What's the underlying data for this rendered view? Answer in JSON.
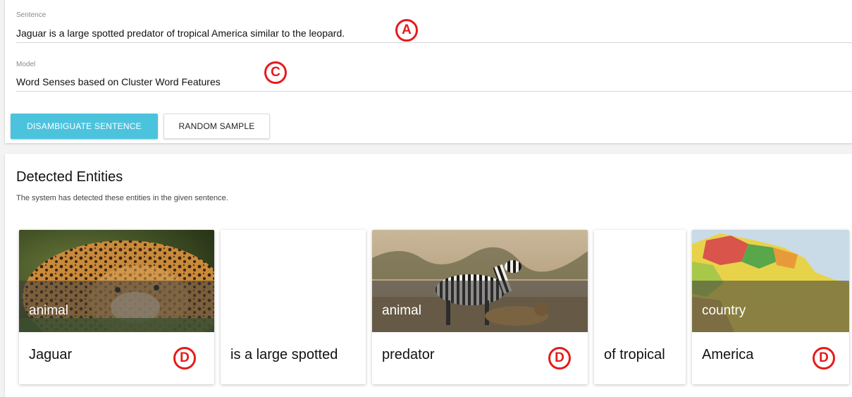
{
  "form": {
    "sentence_label": "Sentence",
    "sentence_value": "Jaguar is a large spotted predator of tropical America similar to the leopard.",
    "model_label": "Model",
    "model_value": "Word Senses based on Cluster Word Features",
    "disambiguate_label": "DISAMBIGUATE SENTENCE",
    "random_label": "RANDOM SAMPLE"
  },
  "markers": {
    "a": "A",
    "c": "C",
    "d": "D"
  },
  "entities": {
    "title": "Detected Entities",
    "description": "The system has detected these entities in the given sentence.",
    "cards": [
      {
        "text": "Jaguar",
        "category": "animal",
        "has_image": true
      },
      {
        "text": "is a large spotted",
        "has_image": false
      },
      {
        "text": "predator",
        "category": "animal",
        "has_image": true
      },
      {
        "text": "of tropical",
        "has_image": false
      },
      {
        "text": "America",
        "category": "country",
        "has_image": true
      }
    ]
  },
  "colors": {
    "primary_button": "#4cc3dd",
    "marker": "#e51b1b"
  }
}
